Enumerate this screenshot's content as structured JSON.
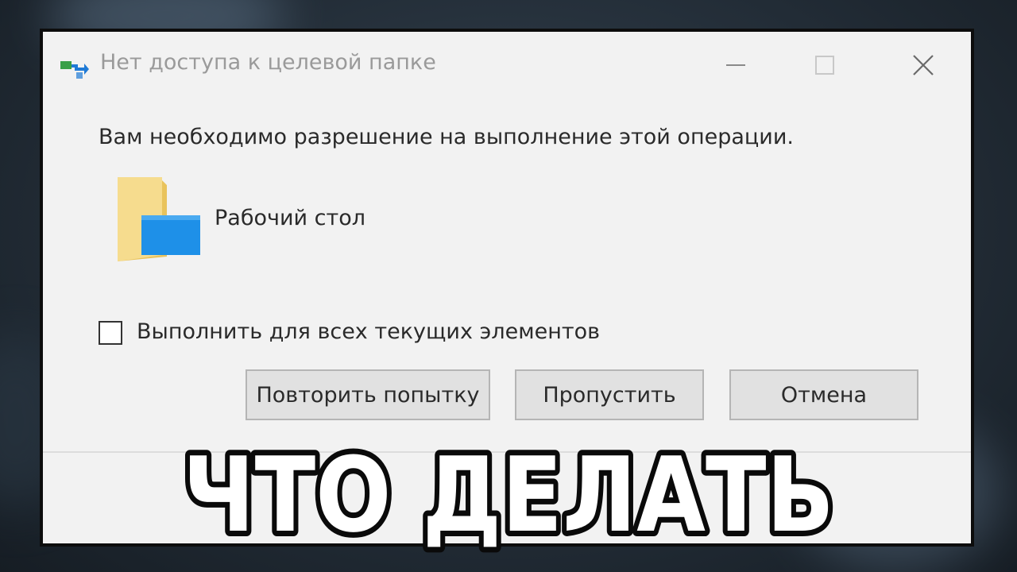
{
  "dialog": {
    "title": "Нет доступа к целевой папке",
    "message": "Вам необходимо разрешение на выполнение этой операции.",
    "folder_name": "Рабочий стол",
    "checkbox_label": "Выполнить для всех текущих элементов",
    "checkbox_checked": false,
    "buttons": {
      "retry": "Повторить попытку",
      "skip": "Пропустить",
      "cancel": "Отмена"
    },
    "window_controls": [
      "minimize-icon",
      "maximize-icon",
      "close-icon"
    ],
    "app_icon": "file-transfer-icon",
    "folder_icon": "desktop-folder-icon"
  },
  "overlay": {
    "caption": "ЧТО ДЕЛАТЬ"
  },
  "colors": {
    "dialog_bg": "#f2f2f2",
    "button_bg": "#e1e1e1",
    "folder_yellow": "#f3d27a",
    "folder_blue": "#1e90e8",
    "transfer_green": "#3aa048",
    "transfer_blue": "#1f7ad6"
  }
}
